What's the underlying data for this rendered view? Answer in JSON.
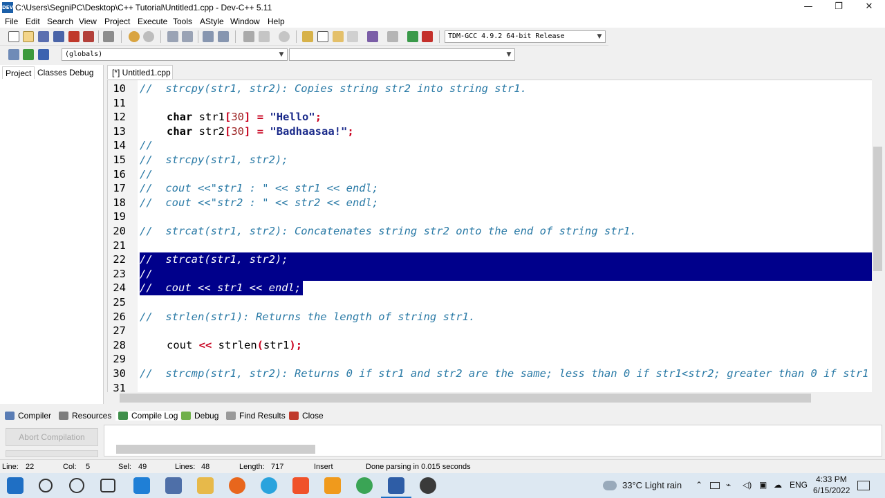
{
  "window": {
    "title": "C:\\Users\\SegniPC\\Desktop\\C++ Tutorial\\Untitled1.cpp - Dev-C++ 5.11",
    "minimize": "—",
    "maximize": "❐",
    "close": "✕",
    "app_icon_text": "DEV"
  },
  "menu": [
    "File",
    "Edit",
    "Search",
    "View",
    "Project",
    "Execute",
    "Tools",
    "AStyle",
    "Window",
    "Help"
  ],
  "toolbar": {
    "compiler_select": "TDM-GCC 4.9.2 64-bit Release",
    "scope_select": "(globals)",
    "member_select": ""
  },
  "left_tabs": [
    "Project",
    "Classes",
    "Debug"
  ],
  "editor": {
    "tab_label": "[*] Untitled1.cpp",
    "lines": [
      {
        "n": "10",
        "text": "//  strcpy(str1, str2): Copies string str2 into string str1."
      },
      {
        "n": "11",
        "text": ""
      },
      {
        "n": "12",
        "kw": "char",
        "rest": " str1",
        "lb": "[",
        "num": "30",
        "rb": "]",
        "eq": " = ",
        "str": "\"Hello\"",
        "semi": ";"
      },
      {
        "n": "13",
        "kw": "char",
        "rest": " str2",
        "lb": "[",
        "num": "30",
        "rb": "]",
        "eq": " = ",
        "str": "\"Badhaasaa!\"",
        "semi": ";"
      },
      {
        "n": "14",
        "text": "//"
      },
      {
        "n": "15",
        "text": "//  strcpy(str1, str2);"
      },
      {
        "n": "16",
        "text": "//"
      },
      {
        "n": "17",
        "text": "//  cout <<\"str1 : \" << str1 << endl;"
      },
      {
        "n": "18",
        "text": "//  cout <<\"str2 : \" << str2 << endl;"
      },
      {
        "n": "19",
        "text": ""
      },
      {
        "n": "20",
        "text": "//  strcat(str1, str2): Concatenates string str2 onto the end of string str1."
      },
      {
        "n": "21",
        "text": ""
      },
      {
        "n": "22",
        "text": "//  strcat(str1, str2);"
      },
      {
        "n": "23",
        "text": "//"
      },
      {
        "n": "24",
        "text": "//  cout << str1 << endl;"
      },
      {
        "n": "25",
        "text": ""
      },
      {
        "n": "26",
        "text": "//  strlen(str1): Returns the length of string str1."
      },
      {
        "n": "27",
        "text": ""
      },
      {
        "n": "28",
        "p1": "cout ",
        "op": "<<",
        "p2": " strlen",
        "lp": "(",
        "p3": "str1",
        "rp": ")",
        "semi": ";"
      },
      {
        "n": "29",
        "text": ""
      },
      {
        "n": "30",
        "text": "//  strcmp(str1, str2): Returns 0 if str1 and str2 are the same; less than 0 if str1<str2; greater than 0 if str1"
      },
      {
        "n": "31",
        "text": ""
      }
    ]
  },
  "bottom_tabs": [
    "Compiler",
    "Resources",
    "Compile Log",
    "Debug",
    "Find Results",
    "Close"
  ],
  "abort_button": "Abort Compilation",
  "status": {
    "line_label": "Line:",
    "line": "22",
    "col_label": "Col:",
    "col": "5",
    "sel_label": "Sel:",
    "sel": "49",
    "lines_label": "Lines:",
    "lines": "48",
    "length_label": "Length:",
    "length": "717",
    "mode": "Insert",
    "message": "Done parsing in 0.015 seconds"
  },
  "taskbar": {
    "weather": "33°C  Light rain",
    "lang": "ENG",
    "time": "4:33 PM",
    "date": "6/15/2022"
  }
}
